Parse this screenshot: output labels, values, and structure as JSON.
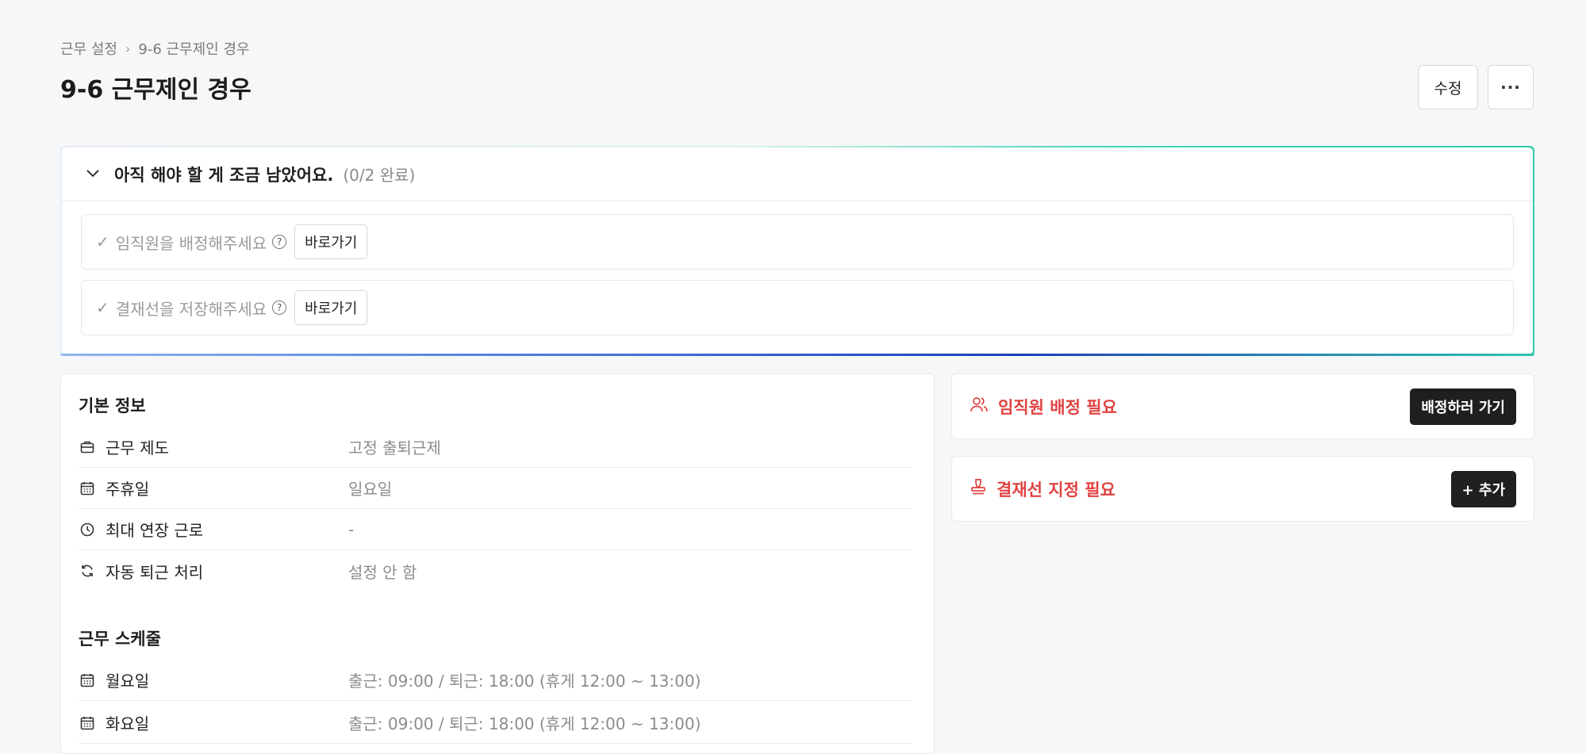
{
  "breadcrumb": {
    "parent": "근무 설정",
    "current": "9-6 근무제인 경우"
  },
  "page": {
    "title": "9-6 근무제인 경우"
  },
  "actions": {
    "edit_label": "수정",
    "more_label": "···"
  },
  "todo": {
    "title": "아직 해야 할 게 조금 남았어요.",
    "progress": "(0/2 완료)",
    "items": [
      {
        "label": "임직원을 배정해주세요",
        "button": "바로가기"
      },
      {
        "label": "결재선을 저장해주세요",
        "button": "바로가기"
      }
    ]
  },
  "basic_info": {
    "title": "기본 정보",
    "rows": [
      {
        "icon": "briefcase-icon",
        "key": "근무 제도",
        "value": "고정 출퇴근제"
      },
      {
        "icon": "calendar-icon",
        "key": "주휴일",
        "value": "일요일"
      },
      {
        "icon": "clock-icon",
        "key": "최대 연장 근로",
        "value": "-"
      },
      {
        "icon": "refresh-icon",
        "key": "자동 퇴근 처리",
        "value": "설정 안 함"
      }
    ]
  },
  "schedule": {
    "title": "근무 스케줄",
    "rows": [
      {
        "icon": "calendar-icon",
        "key": "월요일",
        "value": "출근: 09:00 / 퇴근: 18:00 (휴게 12:00 ~ 13:00)"
      },
      {
        "icon": "calendar-icon",
        "key": "화요일",
        "value": "출근: 09:00 / 퇴근: 18:00 (휴게 12:00 ~ 13:00)"
      }
    ]
  },
  "side": {
    "assign": {
      "icon": "users-icon",
      "label": "임직원 배정 필요",
      "button": "배정하러 가기"
    },
    "approval": {
      "icon": "stamp-icon",
      "label": "결재선 지정 필요",
      "button": "+ 추가"
    }
  },
  "colors": {
    "warning": "#e04242",
    "dark_button": "#1f1f1f",
    "gradient_teal": "#2ec8ad",
    "gradient_blue": "#1c3fb8"
  }
}
